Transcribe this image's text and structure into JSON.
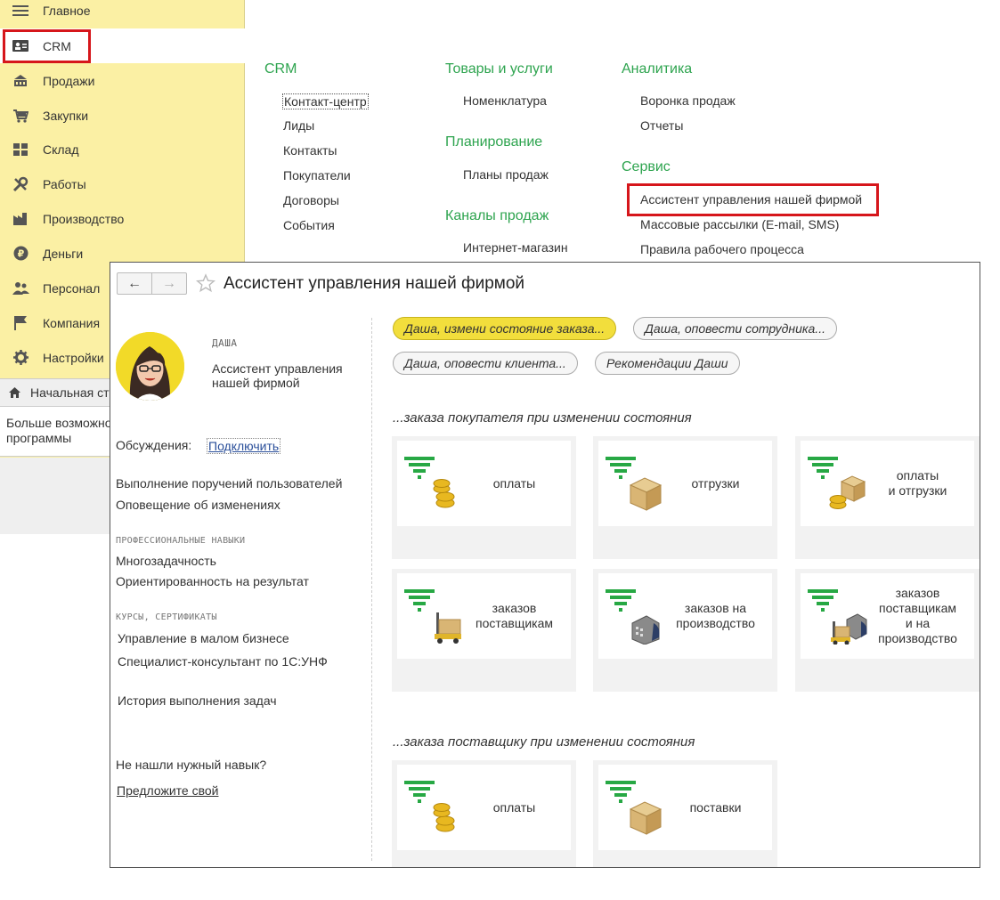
{
  "sidebar": {
    "items": [
      {
        "label": "Главное",
        "icon": "menu-lines-icon"
      },
      {
        "label": "CRM",
        "icon": "contacts-card-icon"
      },
      {
        "label": "Продажи",
        "icon": "cash-register-icon"
      },
      {
        "label": "Закупки",
        "icon": "cart-icon"
      },
      {
        "label": "Склад",
        "icon": "warehouse-boxes-icon"
      },
      {
        "label": "Работы",
        "icon": "tools-icon"
      },
      {
        "label": "Производство",
        "icon": "factory-icon"
      },
      {
        "label": "Деньги",
        "icon": "ruble-coin-icon"
      },
      {
        "label": "Персонал",
        "icon": "people-icon"
      },
      {
        "label": "Компания",
        "icon": "flag-icon"
      },
      {
        "label": "Настройки",
        "icon": "gear-icon"
      }
    ],
    "start_page": "Начальная ст",
    "more_text": "Больше возможно\nпрограммы"
  },
  "menu": {
    "crm": {
      "title": "CRM",
      "links": [
        "Контакт-центр",
        "Лиды",
        "Контакты",
        "Покупатели",
        "Договоры",
        "События"
      ]
    },
    "goods": {
      "title": "Товары и услуги",
      "links": [
        "Номенклатура"
      ]
    },
    "planning": {
      "title": "Планирование",
      "links": [
        "Планы продаж"
      ]
    },
    "channels": {
      "title": "Каналы продаж",
      "links": [
        "Интернет-магазин"
      ]
    },
    "analytics": {
      "title": "Аналитика",
      "links": [
        "Воронка продаж",
        "Отчеты"
      ]
    },
    "service": {
      "title": "Сервис",
      "links": [
        "Ассистент управления нашей фирмой",
        "Массовые рассылки (E-mail, SMS)",
        "Правила рабочего процесса"
      ]
    }
  },
  "window": {
    "title": "Ассистент управления нашей фирмой",
    "back": "←",
    "forward": "→",
    "profile": {
      "name": "ДАША",
      "role": "Ассистент управления нашей фирмой",
      "discussions_label": "Обсуждения:",
      "discussions_link": "Подключить",
      "duties": [
        "Выполнение поручений пользователей",
        "Оповещение об изменениях"
      ],
      "skills_header": "ПРОФЕССИОНАЛЬНЫЕ НАВЫКИ",
      "skills": [
        "Многозадачность",
        "Ориентированность на результат"
      ],
      "courses_header": "КУРСЫ, СЕРТИФИКАТЫ",
      "courses": [
        "Управление в малом бизнесе",
        "Специалист-консультант по 1С:УНФ"
      ],
      "history": "История выполнения задач",
      "not_found": "Не нашли нужный навык?",
      "suggest": "Предложите свой"
    },
    "actions": [
      "Даша, измени состояние заказа...",
      "Даша, оповести сотрудника...",
      "Даша, оповести клиента...",
      "Рекомендации Даши"
    ],
    "sections": [
      {
        "title": "...заказа покупателя при изменении состояния",
        "tiles": [
          {
            "label": "оплаты",
            "icon": "funnel-coins-icon"
          },
          {
            "label": "отгрузки",
            "icon": "funnel-box-icon"
          },
          {
            "label": "оплаты\nи отгрузки",
            "icon": "funnel-box-coins-icon"
          },
          {
            "label": "заказов\nпоставщикам",
            "icon": "funnel-loader-icon"
          },
          {
            "label": "заказов на\nпроизводство",
            "icon": "funnel-factory-icon"
          },
          {
            "label": "заказов\nпоставщикам\nи на\nпроизводство",
            "icon": "funnel-loader-factory-icon"
          }
        ]
      },
      {
        "title": "...заказа поставщику при изменении состояния",
        "tiles": [
          {
            "label": "оплаты",
            "icon": "funnel-coins-icon"
          },
          {
            "label": "поставки",
            "icon": "funnel-box-icon"
          }
        ]
      }
    ]
  },
  "colors": {
    "sidebar": "#fbf0a4",
    "menu_heading": "#2ea44f",
    "highlight": "#d6161b",
    "active_pill": "#f2de3c",
    "funnel": "#27a844"
  }
}
